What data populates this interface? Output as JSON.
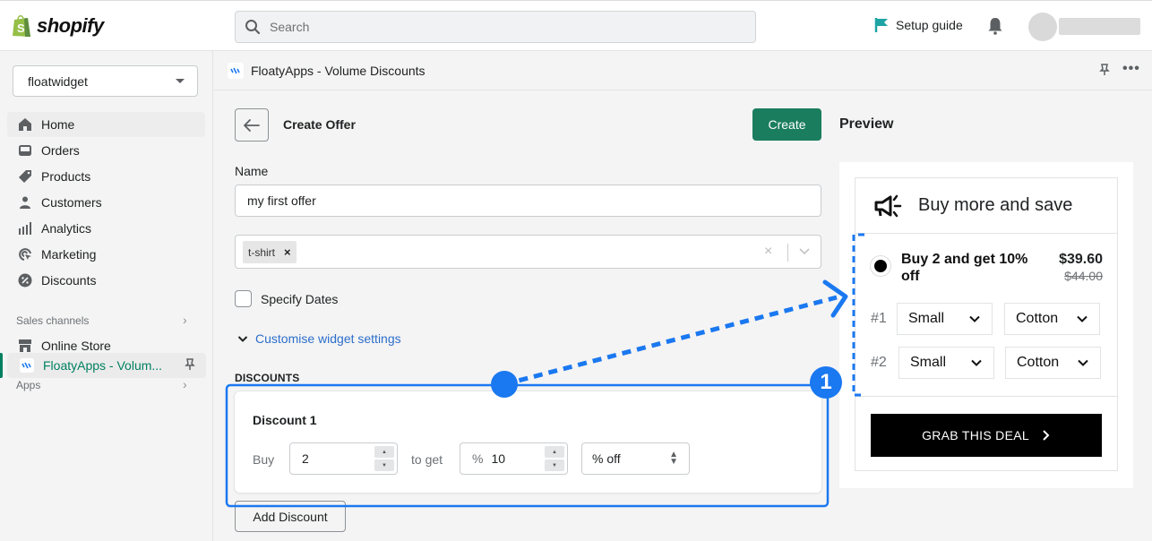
{
  "topbar": {
    "brand": "shopify",
    "search_placeholder": "Search",
    "setup_guide": "Setup guide",
    "brand_color": "#95bf47",
    "flag_color": "#1ea4a4"
  },
  "sidebar": {
    "store": "floatwidget",
    "items": [
      {
        "label": "Home",
        "icon": "home-icon"
      },
      {
        "label": "Orders",
        "icon": "orders-icon"
      },
      {
        "label": "Products",
        "icon": "tag-icon"
      },
      {
        "label": "Customers",
        "icon": "person-icon"
      },
      {
        "label": "Analytics",
        "icon": "bar-chart-icon"
      },
      {
        "label": "Marketing",
        "icon": "target-icon"
      },
      {
        "label": "Discounts",
        "icon": "discount-icon"
      }
    ],
    "sales_channels_label": "Sales channels",
    "online_store": "Online Store",
    "apps_label": "Apps",
    "app_item": "FloatyApps - Volum..."
  },
  "appbar": {
    "title": "FloatyApps - Volume Discounts"
  },
  "form": {
    "page_title": "Create Offer",
    "create_label": "Create",
    "name_label": "Name",
    "name_value": "my first offer",
    "product_tag": "t-shirt",
    "specify_dates": "Specify Dates",
    "customise": "Customise widget settings",
    "discounts_heading": "DISCOUNTS",
    "discount": {
      "title": "Discount 1",
      "buy_label": "Buy",
      "buy_qty": "2",
      "to_get_label": "to get",
      "percent_prefix": "%",
      "amount": "10",
      "type": "% off"
    },
    "add_discount": "Add Discount"
  },
  "preview": {
    "label": "Preview",
    "heading": "Buy more and save",
    "tier_text": "Buy 2 and get 10% off",
    "price_now": "$39.60",
    "price_old": "$44.00",
    "variants": [
      {
        "label": "#1",
        "size": "Small",
        "material": "Cotton"
      },
      {
        "label": "#2",
        "size": "Small",
        "material": "Cotton"
      }
    ],
    "cta": "GRAB THIS DEAL"
  },
  "annotation": {
    "step_number": "1",
    "color": "#1a78f0"
  }
}
